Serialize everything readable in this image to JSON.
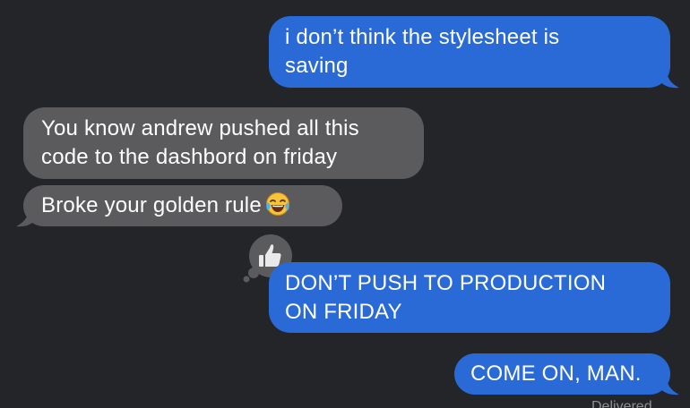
{
  "conversation": {
    "messages": [
      {
        "direction": "outgoing",
        "text": "i don’t think the stylesheet is\nsaving"
      },
      {
        "direction": "incoming",
        "text": "You know andrew pushed all this\ncode to the dashbord on friday"
      },
      {
        "direction": "incoming",
        "text": "Broke your golden rule",
        "emoji": "face-with-tears-of-joy-icon"
      },
      {
        "direction": "outgoing",
        "text": "DON’T PUSH TO PRODUCTION\nON FRIDAY",
        "reaction": "thumbs-up-icon"
      },
      {
        "direction": "outgoing",
        "text": "COME ON, MAN."
      }
    ],
    "delivered_label": "Delivered"
  },
  "colors": {
    "background": "#232529",
    "outgoing_bubble": "#2a6ad6",
    "incoming_bubble": "#5b5b5e",
    "tapback_bubble": "#5b5b5e"
  }
}
